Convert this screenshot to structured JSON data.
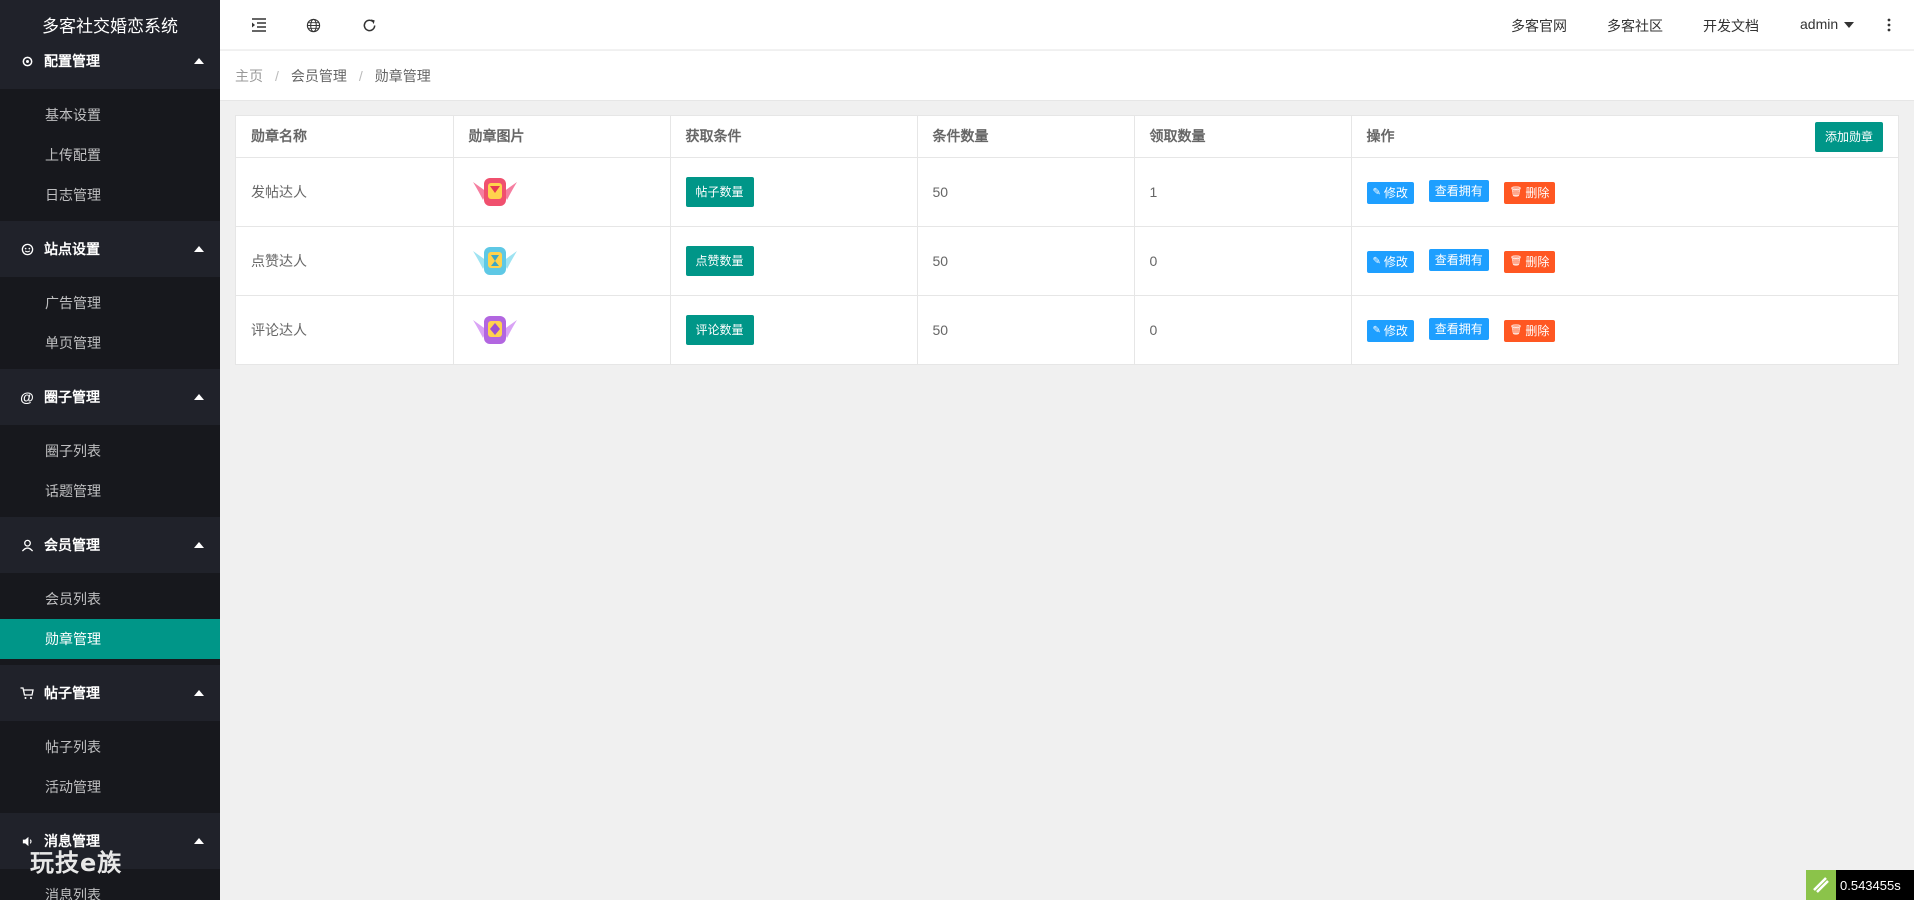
{
  "app": {
    "title": "多客社交婚恋系统"
  },
  "sidebar": {
    "groups": [
      {
        "label": "配置管理",
        "icon": "gear-icon",
        "items": [
          {
            "label": "基本设置"
          },
          {
            "label": "上传配置"
          },
          {
            "label": "日志管理"
          }
        ]
      },
      {
        "label": "站点设置",
        "icon": "smile-icon",
        "items": [
          {
            "label": "广告管理"
          },
          {
            "label": "单页管理"
          }
        ]
      },
      {
        "label": "圈子管理",
        "icon": "at-icon",
        "items": [
          {
            "label": "圈子列表"
          },
          {
            "label": "话题管理"
          }
        ]
      },
      {
        "label": "会员管理",
        "icon": "user-icon",
        "items": [
          {
            "label": "会员列表"
          },
          {
            "label": "勋章管理",
            "active": true
          }
        ]
      },
      {
        "label": "帖子管理",
        "icon": "cart-icon",
        "items": [
          {
            "label": "帖子列表"
          },
          {
            "label": "活动管理"
          }
        ]
      },
      {
        "label": "消息管理",
        "icon": "speaker-icon",
        "items": [
          {
            "label": "消息列表"
          }
        ]
      }
    ],
    "watermark": "玩技e族"
  },
  "header": {
    "icons": [
      "menu-fold-icon",
      "globe-icon",
      "refresh-icon"
    ],
    "links": [
      "多客官网",
      "多客社区",
      "开发文档"
    ],
    "user": "admin"
  },
  "breadcrumb": [
    "主页",
    "会员管理",
    "勋章管理"
  ],
  "table": {
    "columns": [
      "勋章名称",
      "勋章图片",
      "获取条件",
      "条件数量",
      "领取数量",
      "操作"
    ],
    "add_button": "添加勋章",
    "actions": {
      "edit": "修改",
      "view": "查看拥有",
      "delete": "删除"
    },
    "rows": [
      {
        "name": "发帖达人",
        "badge_color": "#f0506e",
        "condition": "帖子数量",
        "count": "50",
        "claimed": "1"
      },
      {
        "name": "点赞达人",
        "badge_color": "#5ec8e5",
        "condition": "点赞数量",
        "count": "50",
        "claimed": "0"
      },
      {
        "name": "评论达人",
        "badge_color": "#b266e0",
        "condition": "评论数量",
        "count": "50",
        "claimed": "0"
      }
    ]
  },
  "timer": {
    "value": "0.543455s"
  },
  "colors": {
    "primary": "#009688",
    "blue": "#1e9fff",
    "danger": "#ff5722",
    "sidebar": "#20222a"
  }
}
